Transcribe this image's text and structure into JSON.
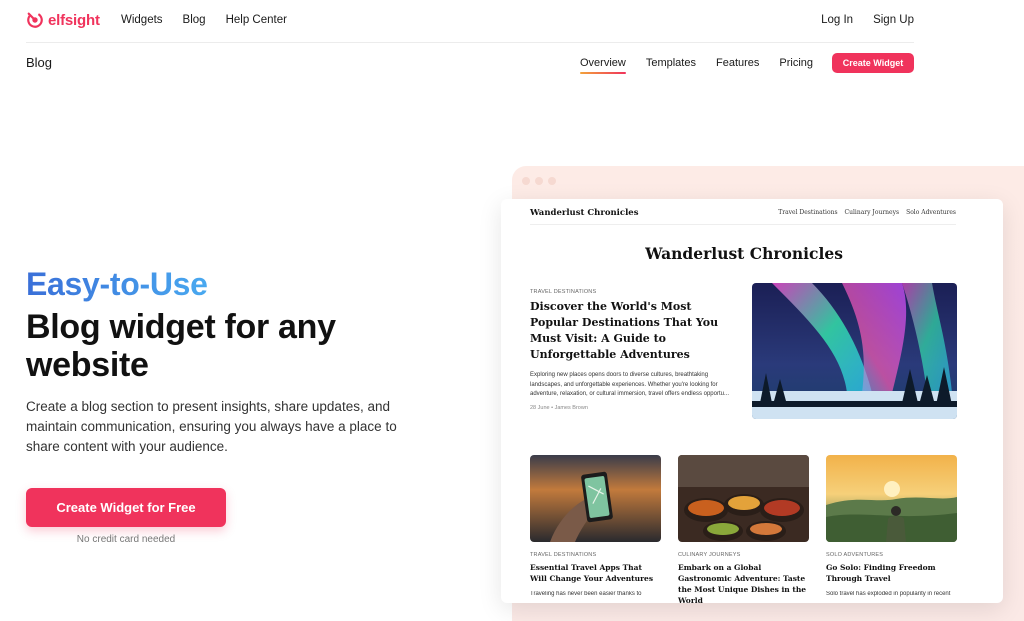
{
  "topnav": {
    "brand": "elfsight",
    "links": [
      "Widgets",
      "Blog",
      "Help Center"
    ],
    "login": "Log In",
    "signup": "Sign Up"
  },
  "subnav": {
    "title": "Blog",
    "links": [
      "Overview",
      "Templates",
      "Features",
      "Pricing"
    ],
    "active": "Overview",
    "cta": "Create Widget"
  },
  "hero": {
    "eyebrow": "Easy-to-Use",
    "title": "Blog widget for any website",
    "description": "Create a blog section to present insights, share updates, and maintain communication, ensuring you always have a place to share content with your audience.",
    "cta": "Create Widget for Free",
    "note": "No credit card needed"
  },
  "preview": {
    "site_name": "Wanderlust Chronicles",
    "nav": [
      "Travel Destinations",
      "Culinary Journeys",
      "Solo Adventures"
    ],
    "heading": "Wanderlust Chronicles",
    "featured": {
      "category": "TRAVEL DESTINATIONS",
      "title": "Discover the World's Most Popular Destinations That You Must Visit: A Guide to Unforgettable Adventures",
      "excerpt": "Exploring new places opens doors to diverse cultures, breathtaking landscapes, and unforgettable experiences. Whether you're looking for adventure, relaxation, or cultural immersion, travel offers endless opportu...",
      "date": "28 June",
      "author": "James Brown"
    },
    "posts": [
      {
        "category": "TRAVEL DESTINATIONS",
        "title": "Essential Travel Apps That Will Change Your Adventures",
        "excerpt": "Traveling has never been easier thanks to"
      },
      {
        "category": "CULINARY JOURNEYS",
        "title": "Embark on a Global Gastronomic Adventure: Taste the Most Unique Dishes in the World",
        "excerpt": ""
      },
      {
        "category": "SOLO ADVENTURES",
        "title": "Go Solo: Finding Freedom Through Travel",
        "excerpt": "Solo travel has exploded in popularity in recent"
      }
    ]
  },
  "colors": {
    "brand": "#f0335c",
    "eyebrow_gradient": [
      "#3a6fd8",
      "#49a9f0"
    ],
    "peach": "#fdebe6"
  }
}
